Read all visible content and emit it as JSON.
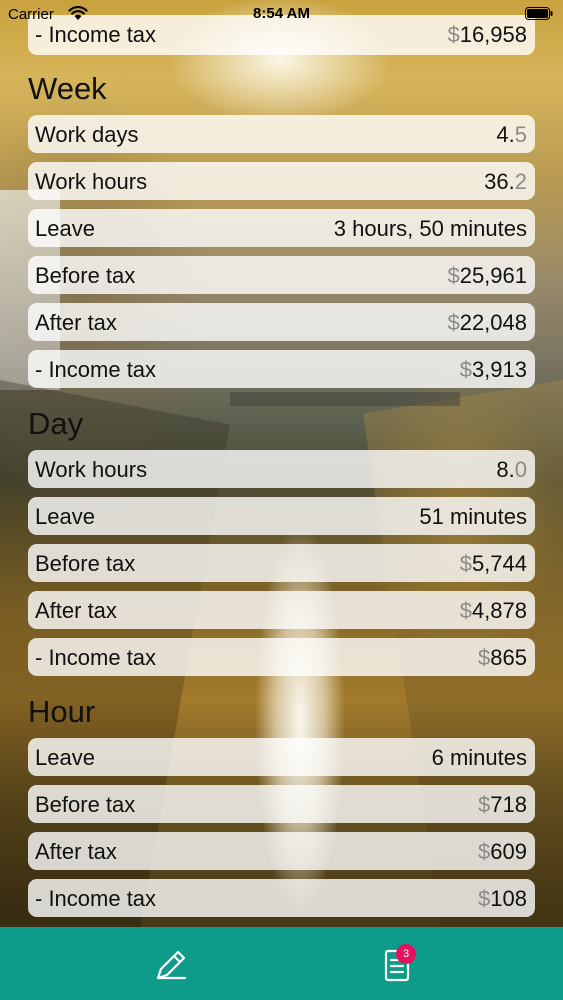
{
  "status_bar": {
    "carrier": "Carrier",
    "time": "8:54 AM",
    "icons": [
      "wifi-icon",
      "battery-icon"
    ]
  },
  "top_row": {
    "label": "- Income tax",
    "currency": "$",
    "amount": "16,958"
  },
  "week": {
    "title": "Week",
    "rows": [
      {
        "label": "Work days",
        "value_main": "4.",
        "value_dim": "5"
      },
      {
        "label": "Work hours",
        "value_main": "36.",
        "value_dim": "2"
      },
      {
        "label": "Leave",
        "value": "3 hours, 50 minutes"
      },
      {
        "label": "Before tax",
        "currency": "$",
        "amount": "25,961"
      },
      {
        "label": "After tax",
        "currency": "$",
        "amount": "22,048"
      },
      {
        "label": "- Income tax",
        "currency": "$",
        "amount": "3,913"
      }
    ]
  },
  "day": {
    "title": "Day",
    "rows": [
      {
        "label": "Work hours",
        "value_main": "8.",
        "value_dim": "0"
      },
      {
        "label": "Leave",
        "value": "51 minutes"
      },
      {
        "label": "Before tax",
        "currency": "$",
        "amount": "5,744"
      },
      {
        "label": "After tax",
        "currency": "$",
        "amount": "4,878"
      },
      {
        "label": "- Income tax",
        "currency": "$",
        "amount": "865"
      }
    ]
  },
  "hour": {
    "title": "Hour",
    "rows": [
      {
        "label": "Leave",
        "value": "6 minutes"
      },
      {
        "label": "Before tax",
        "currency": "$",
        "amount": "718"
      },
      {
        "label": "After tax",
        "currency": "$",
        "amount": "609"
      },
      {
        "label": "- Income tax",
        "currency": "$",
        "amount": "108"
      }
    ]
  },
  "tab_bar": {
    "background": "#0f9b8a",
    "tabs": [
      {
        "name": "edit",
        "icon": "pencil-icon"
      },
      {
        "name": "summary",
        "icon": "list-icon",
        "badge": "3"
      }
    ],
    "badge_color": "#e3125e"
  }
}
